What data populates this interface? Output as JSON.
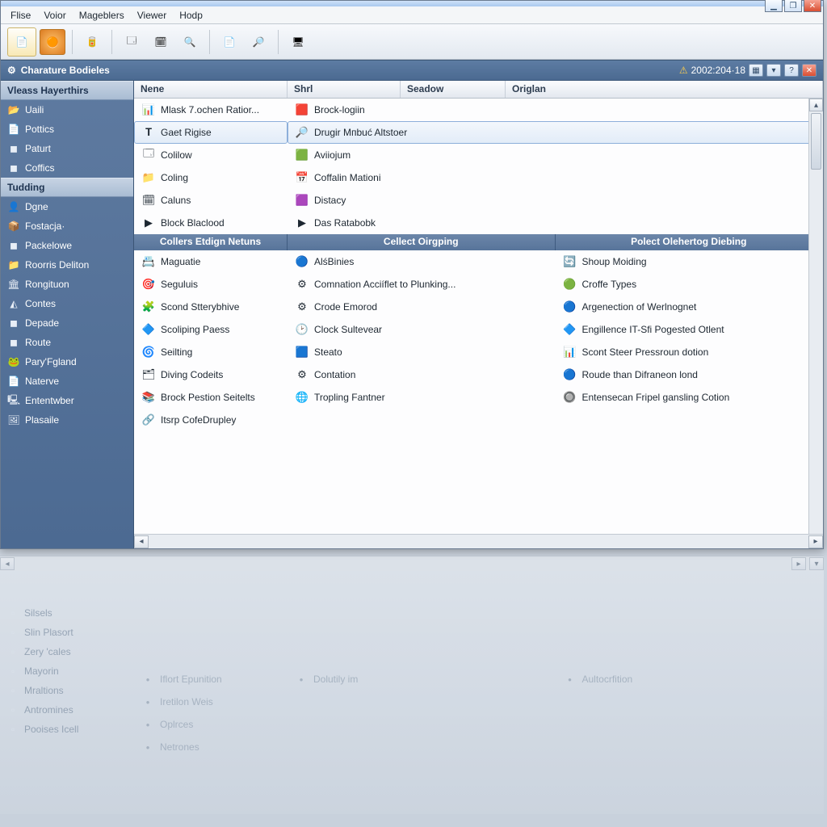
{
  "menu": {
    "file": "Flise",
    "view": "Voior",
    "managers": "Mageblers",
    "viewer": "Viewer",
    "help": "Hodp"
  },
  "toolbar": {
    "icons": [
      "📄",
      "🟠",
      "🥫",
      "🗔",
      "🗓",
      "🔍",
      "📄",
      "🔎",
      "🖥"
    ]
  },
  "band": {
    "title": "Charature Bodieles",
    "stamp": "2002:204·18"
  },
  "columns": {
    "name": "Nene",
    "shell": "Shrl",
    "shadow": "Seadow",
    "origin": "Origlan"
  },
  "sidebar": {
    "heading1": "Vleass Hayerthirs",
    "group1": [
      {
        "icon": "📂",
        "label": "Uaili"
      },
      {
        "icon": "📄",
        "label": "Pottics"
      },
      {
        "icon": "◼",
        "label": "Paturt"
      },
      {
        "icon": "◼",
        "label": "Coffics"
      }
    ],
    "heading2": "Tudding",
    "group2": [
      {
        "icon": "👤",
        "label": "Dgne"
      },
      {
        "icon": "📦",
        "label": "Fostacja·"
      },
      {
        "icon": "◼",
        "label": "Packelowe"
      },
      {
        "icon": "📁",
        "label": "Roorris Deliton"
      },
      {
        "icon": "🏛",
        "label": "Rongituon"
      },
      {
        "icon": "◭",
        "label": "Contes"
      },
      {
        "icon": "◼",
        "label": "Depade"
      },
      {
        "icon": "◼",
        "label": "Route"
      },
      {
        "icon": "🐸",
        "label": "Pary'Fgland"
      },
      {
        "icon": "📄",
        "label": "Naterve"
      },
      {
        "icon": "🖳",
        "label": "Ententwber"
      },
      {
        "icon": "🖼",
        "label": "Plasaile"
      }
    ]
  },
  "top_list": {
    "left": [
      {
        "icon": "📊",
        "label": "Mlask 7.ochen Ratior..."
      },
      {
        "icon": "𝐓",
        "label": "Gaet Rigise",
        "selected": true
      },
      {
        "icon": "🗔",
        "label": "Colilow"
      },
      {
        "icon": "📁",
        "label": "Coling"
      },
      {
        "icon": "🗓",
        "label": "Caluns"
      },
      {
        "icon": "▶",
        "label": "Block Blaclood"
      }
    ],
    "right": [
      {
        "icon": "🟥",
        "label": "Brock-logiin"
      },
      {
        "icon": "🔎",
        "label": "Drugir Mпbuć Altstoer",
        "selected": true
      },
      {
        "icon": "🟩",
        "label": "Aviiojum"
      },
      {
        "icon": "📅",
        "label": "Coffalin Mationi"
      },
      {
        "icon": "🟪",
        "label": "Distacy"
      },
      {
        "icon": "▶",
        "label": "Das Ratabobk"
      }
    ]
  },
  "sub_headers": {
    "a": "Collers Etdign Netuns",
    "b": "Cellect Oirgping",
    "c": "Polect Olehertog Diebing"
  },
  "three_cols": {
    "a": [
      {
        "icon": "📇",
        "label": "Maguatie"
      },
      {
        "icon": "🎯",
        "label": "Seguluis"
      },
      {
        "icon": "🧩",
        "label": "Scond Stterybhive"
      },
      {
        "icon": "🔷",
        "label": "Scoliping Paess"
      },
      {
        "icon": "🌀",
        "label": "Seilting"
      },
      {
        "icon": "🗂",
        "label": "Diving Codeits"
      },
      {
        "icon": "📚",
        "label": "Brock Pestion Seitelts"
      },
      {
        "icon": "🔗",
        "label": "Itsrp CofeDrupley"
      }
    ],
    "b": [
      {
        "icon": "🔵",
        "label": "AlśBinies"
      },
      {
        "icon": "⚙",
        "label": "Comnation Acciíflet to Plunking..."
      },
      {
        "icon": "⚙",
        "label": "Crode Emorod"
      },
      {
        "icon": "🕑",
        "label": "Clock Sultevear"
      },
      {
        "icon": "🟦",
        "label": "Steato"
      },
      {
        "icon": "⚙",
        "label": "Contation"
      },
      {
        "icon": "🌐",
        "label": "Tropling Fantner"
      }
    ],
    "c": [
      {
        "icon": "🔄",
        "label": "Shoup Moiding"
      },
      {
        "icon": "🟢",
        "label": "Croffe Types"
      },
      {
        "icon": "🔵",
        "label": "Argenection of Werlnognet"
      },
      {
        "icon": "🔷",
        "label": "Engillence IT-Sfi Pogested Otlent"
      },
      {
        "icon": "📊",
        "label": "Scont Steer Pressroun dotion"
      },
      {
        "icon": "🔵",
        "label": "Roude than Difraneon lond"
      },
      {
        "icon": "🔘",
        "label": "Entensecan Fripel gansling Cotion"
      }
    ]
  },
  "lower": {
    "side": [
      {
        "label": "Silsels"
      },
      {
        "label": "Slin Plasort"
      },
      {
        "label": "Zery 'cales"
      },
      {
        "label": "Mayorin"
      },
      {
        "label": "Mraltions"
      },
      {
        "label": "Antromines"
      },
      {
        "label": "Pooises Icell"
      }
    ],
    "cols": {
      "a": [
        {
          "label": "Iflort Epunition"
        },
        {
          "label": "Iretilon Weis"
        },
        {
          "label": "Oplrces"
        },
        {
          "label": "Netrones"
        }
      ],
      "b": [
        {
          "label": "Dolutily im"
        }
      ],
      "c": [
        {
          "label": "Aultocrfition"
        }
      ]
    }
  }
}
